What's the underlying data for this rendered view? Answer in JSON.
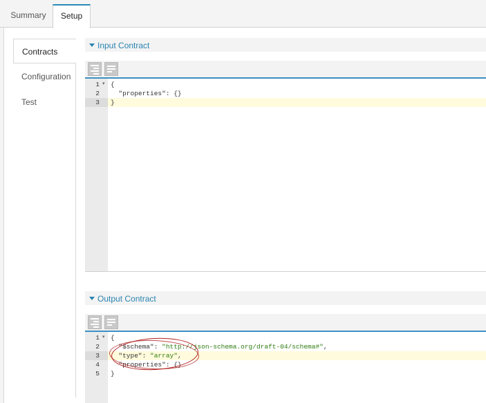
{
  "tabs": {
    "summary": "Summary",
    "setup": "Setup"
  },
  "sidebar": {
    "items": [
      {
        "label": "Contracts"
      },
      {
        "label": "Configuration"
      },
      {
        "label": "Test"
      }
    ]
  },
  "input_contract": {
    "title": "Input Contract",
    "lines": [
      {
        "num": "1",
        "text": "{"
      },
      {
        "num": "2",
        "text": "  \"properties\": {}"
      },
      {
        "num": "3",
        "text": "}"
      }
    ]
  },
  "output_contract": {
    "title": "Output Contract",
    "lines": [
      {
        "num": "1",
        "text": "{"
      },
      {
        "num": "2",
        "key": "  \"$schema\"",
        "sep": ": ",
        "val": "\"http://json-schema.org/draft-04/schema#\"",
        "end": ","
      },
      {
        "num": "3",
        "key": "  \"type\"",
        "sep": ": ",
        "val": "\"array\"",
        "end": ","
      },
      {
        "num": "4",
        "text": "  \"properties\": {}"
      },
      {
        "num": "5",
        "text": "}"
      }
    ]
  },
  "colors": {
    "accent": "#2a84b0",
    "annotation": "#b02020",
    "string": "#2e7d12"
  }
}
